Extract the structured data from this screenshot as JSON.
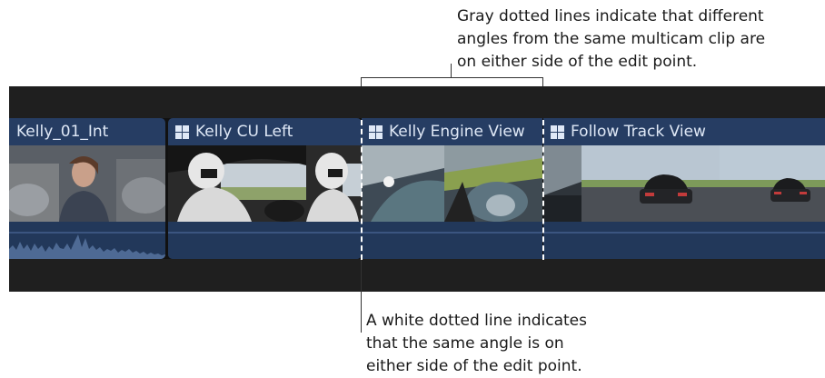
{
  "callout_top": {
    "lines": [
      "Gray dotted lines indicate that different",
      "angles from the same multicam clip are",
      "on either side of the edit point."
    ]
  },
  "callout_bottom": {
    "lines": [
      "A white dotted line indicates",
      "that the same angle is on",
      "either side of the edit point."
    ]
  },
  "clips": [
    {
      "title": "Kelly_01_Int",
      "multicam": false
    },
    {
      "title": "Kelly CU Left",
      "multicam": true
    },
    {
      "title": "Kelly Engine View",
      "multicam": true
    },
    {
      "title": "Follow Track View",
      "multicam": true
    }
  ],
  "colors": {
    "clip_fill": "#263d63",
    "clip_title": "#dfe8f6",
    "timeline_bg": "#1f1f1f",
    "edit_line_same_angle": "#ffffff",
    "edit_line_different_angle": "#8a8a8a"
  }
}
